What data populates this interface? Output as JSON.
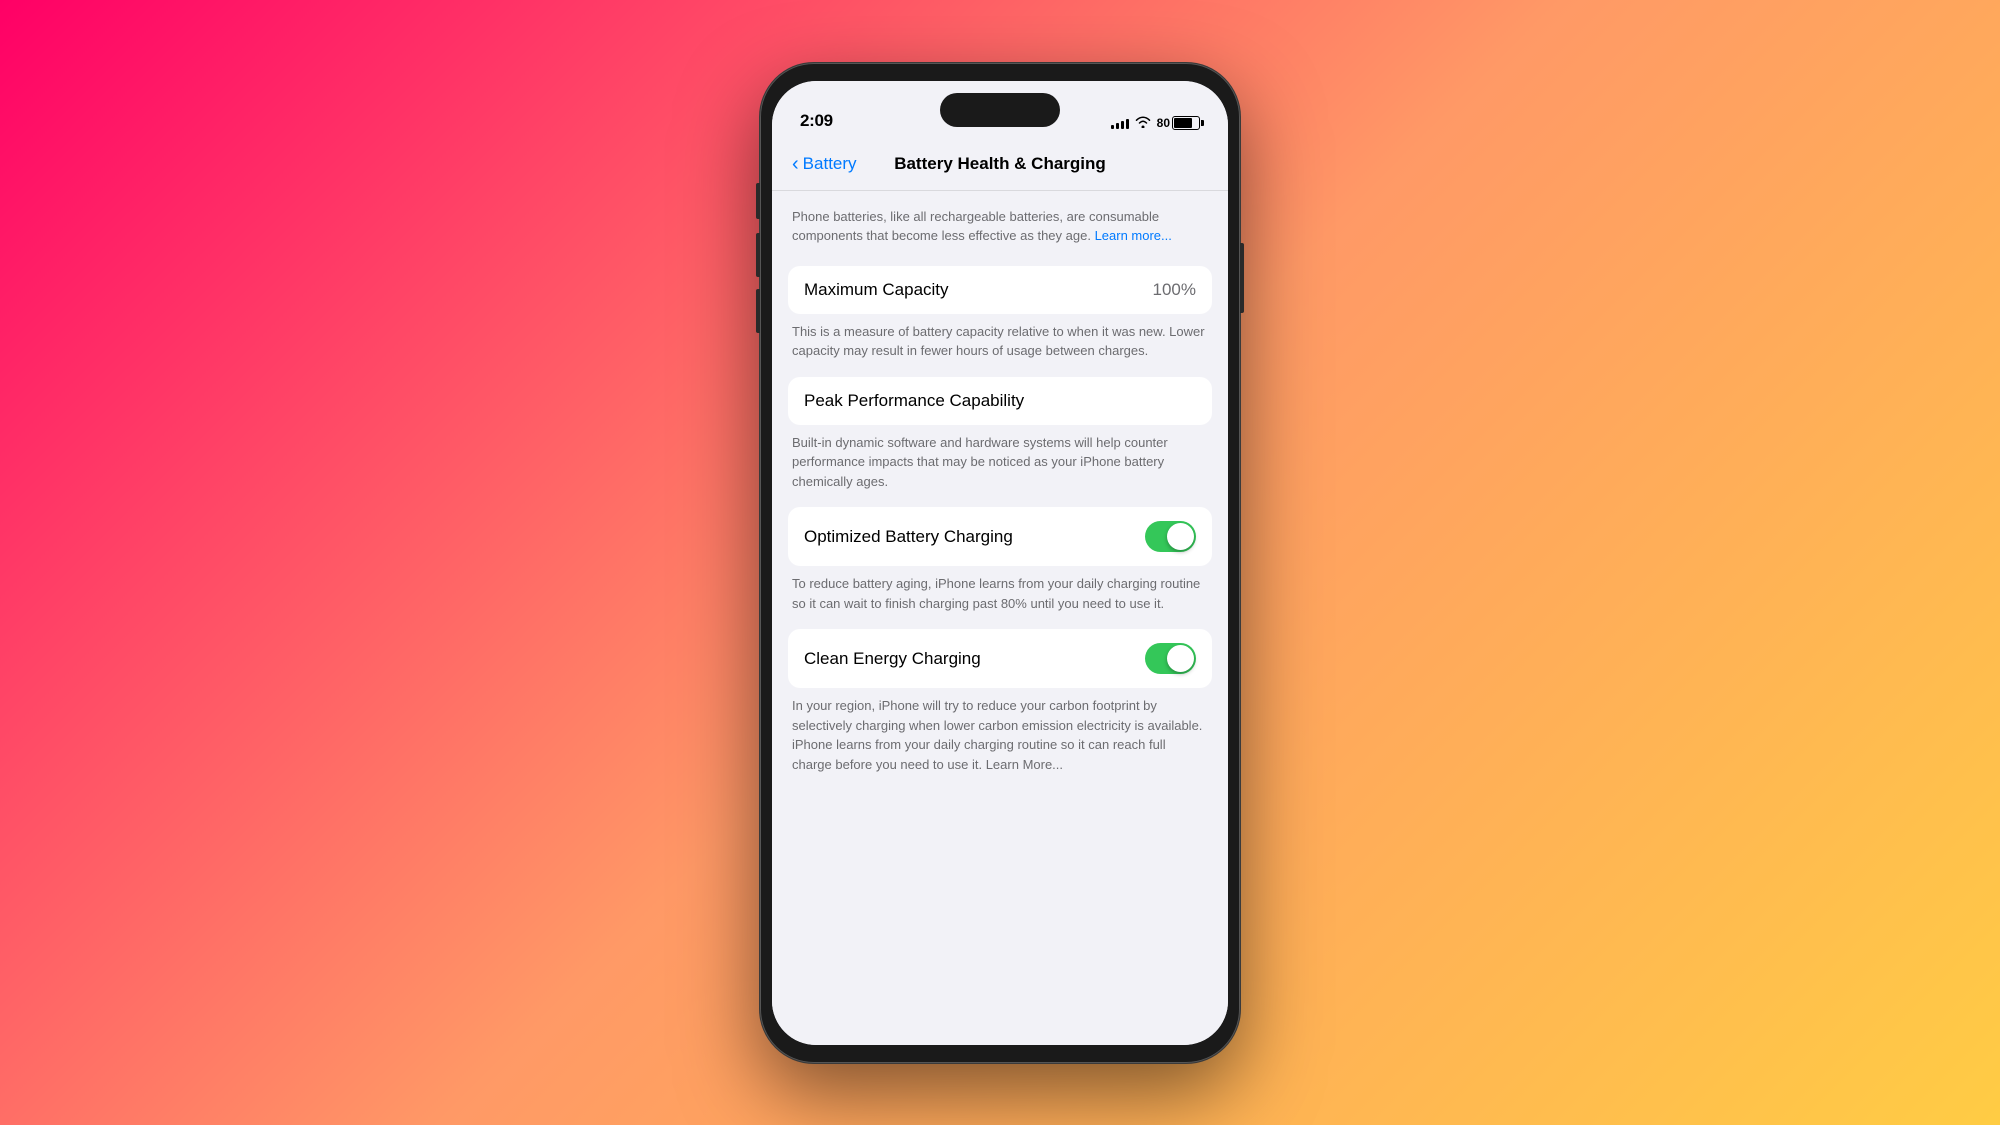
{
  "background": {
    "gradient": "135deg, #f06 0%, #ff9966 50%, #ffcc44 100%"
  },
  "statusBar": {
    "time": "2:09",
    "batteryPercent": "80",
    "signalBars": [
      3,
      5,
      7,
      9,
      11
    ]
  },
  "navigation": {
    "backLabel": "Battery",
    "title": "Battery Health & Charging"
  },
  "content": {
    "introText": "Phone batteries, like all rechargeable batteries, are consumable components that become less effective as they age.",
    "learnMoreLabel": "Learn more...",
    "maximumCapacity": {
      "label": "Maximum Capacity",
      "value": "100%",
      "description": "This is a measure of battery capacity relative to when it was new. Lower capacity may result in fewer hours of usage between charges."
    },
    "peakPerformance": {
      "label": "Peak Performance Capability",
      "description": "Built-in dynamic software and hardware systems will help counter performance impacts that may be noticed as your iPhone battery chemically ages."
    },
    "optimizedCharging": {
      "label": "Optimized Battery Charging",
      "enabled": true,
      "description": "To reduce battery aging, iPhone learns from your daily charging routine so it can wait to finish charging past 80% until you need to use it."
    },
    "cleanEnergy": {
      "label": "Clean Energy Charging",
      "enabled": true,
      "description": "In your region, iPhone will try to reduce your carbon footprint by selectively charging when lower carbon emission electricity is available. iPhone learns from your daily charging routine so it can reach full charge before you need to use it.",
      "learnMoreLabel": "Learn More..."
    }
  }
}
